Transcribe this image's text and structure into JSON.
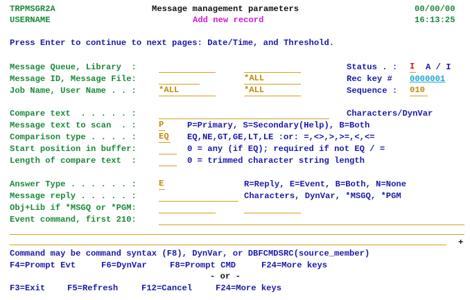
{
  "header": {
    "program": "TRPMSGR2A",
    "user": "USERNAME",
    "title": "Message management parameters",
    "subtitle": "Add new record",
    "date": "00/00/00",
    "time": "16:13:25"
  },
  "instructions": "Press Enter to continue to next pages: Date/Time, and Threshold.",
  "labels": {
    "msgq": "Message Queue, Library  :",
    "msgid": "Message ID, Message File:",
    "job": "Job Name, User Name . . :",
    "status": "Status . :",
    "status_hint": "A / I",
    "reckey": "Rec key #",
    "sequence": "Sequence :",
    "compare": "Compare text  . . . . . :",
    "compare_hint": "Characters/DynVar",
    "scan": "Message text to scan  . :",
    "scan_hint": "P=Primary, S=Secondary(Help), B=Both",
    "comptype": "Comparison type . . . . :",
    "comptype_hint": "EQ,NE,GT,GE,LT,LE :or: =,<>,>,>=,<,<=",
    "startpos": "Start position in buffer:",
    "startpos_hint": "0 = any (if EQ); required if not EQ / =",
    "length": "Length of compare text  :",
    "length_hint": "0 = trimmed character string length",
    "answer": "Answer Type . . . . . . :",
    "answer_hint": "R=Reply, E=Event, B=Both, N=None",
    "reply": "Message reply . . . . . :",
    "reply_hint": "Characters, DynVar, *MSGQ, *PGM",
    "objlib": "Obj+Lib if *MSGQ or *PGM:",
    "event": "Event command, first 210:"
  },
  "fields": {
    "msgq": "",
    "msgq_lib": "",
    "msgid": "",
    "msgfile": "*ALL",
    "job": "*ALL",
    "user": "*ALL",
    "status": "I",
    "reckey": "0000001",
    "sequence": "010",
    "compare": "",
    "scan": "P",
    "comptype": "EQ",
    "startpos": "",
    "length": "",
    "answer": "E",
    "reply": "",
    "obj": "",
    "lib": "",
    "event": ""
  },
  "more": "+",
  "footer": {
    "note": "Command may be command syntax (F8), DynVar, or DBFCMDSRC(source_member)",
    "keys1": [
      "F4=Prompt Evt",
      "F6=DynVar",
      "F8=Prompt CMD",
      "F24=More keys"
    ],
    "or": "- or -",
    "keys2": [
      "F3=Exit",
      "F5=Refresh",
      "F12=Cancel",
      "F24=More keys"
    ]
  }
}
